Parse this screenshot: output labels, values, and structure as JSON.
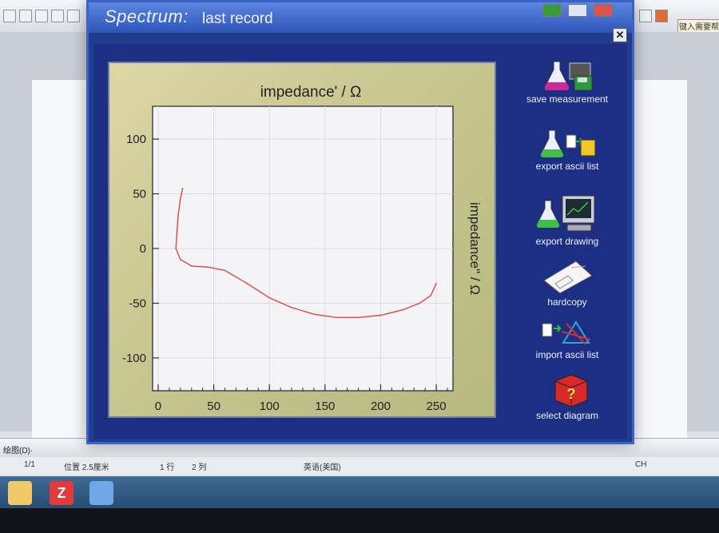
{
  "window": {
    "title": "Spectrum:",
    "subtitle": "last record",
    "close_glyph": "✕"
  },
  "plot": {
    "top_axis_title": "impedance' / Ω",
    "right_axis_title": "impedance\" / Ω"
  },
  "chart_data": {
    "type": "line",
    "xlabel": "impedance' / Ω",
    "ylabel": "impedance\" / Ω",
    "xlim": [
      -5,
      265
    ],
    "ylim": [
      -130,
      130
    ],
    "x_ticks": [
      "0",
      "50",
      "100",
      "150",
      "200",
      "250"
    ],
    "y_ticks": [
      "100",
      "50",
      "0",
      "-50",
      "-100"
    ],
    "grid": true,
    "series": [
      {
        "color": "#d9484a",
        "x": [
          22,
          20,
          18,
          17,
          16,
          20,
          30,
          45,
          60,
          80,
          100,
          120,
          140,
          160,
          180,
          200,
          220,
          235,
          245,
          250
        ],
        "y": [
          55,
          45,
          30,
          15,
          0,
          -10,
          -16,
          -17,
          -20,
          -32,
          -45,
          -54,
          -60,
          -63,
          -63,
          -61,
          -56,
          -50,
          -43,
          -32
        ]
      }
    ]
  },
  "actions": [
    {
      "label": "save measurement",
      "icon": "flask-floppy-icon"
    },
    {
      "label": "export ascii list",
      "icon": "flask-export-list-icon"
    },
    {
      "label": "export drawing",
      "icon": "flask-monitor-icon"
    },
    {
      "label": "hardcopy",
      "icon": "paper-sheet-icon"
    },
    {
      "label": "import ascii list",
      "icon": "import-graph-icon"
    },
    {
      "label": "select diagram",
      "icon": "cube-question-icon"
    }
  ],
  "background": {
    "right_box_text": "键入需要帮助",
    "status_page": "1/1",
    "status_pos": "位置 2.5厘米",
    "status_row": "1 行",
    "status_col": "2 列",
    "status_lang": "英语(美国)",
    "draw_label": "绘图(D)·",
    "tray_text": "CH"
  }
}
